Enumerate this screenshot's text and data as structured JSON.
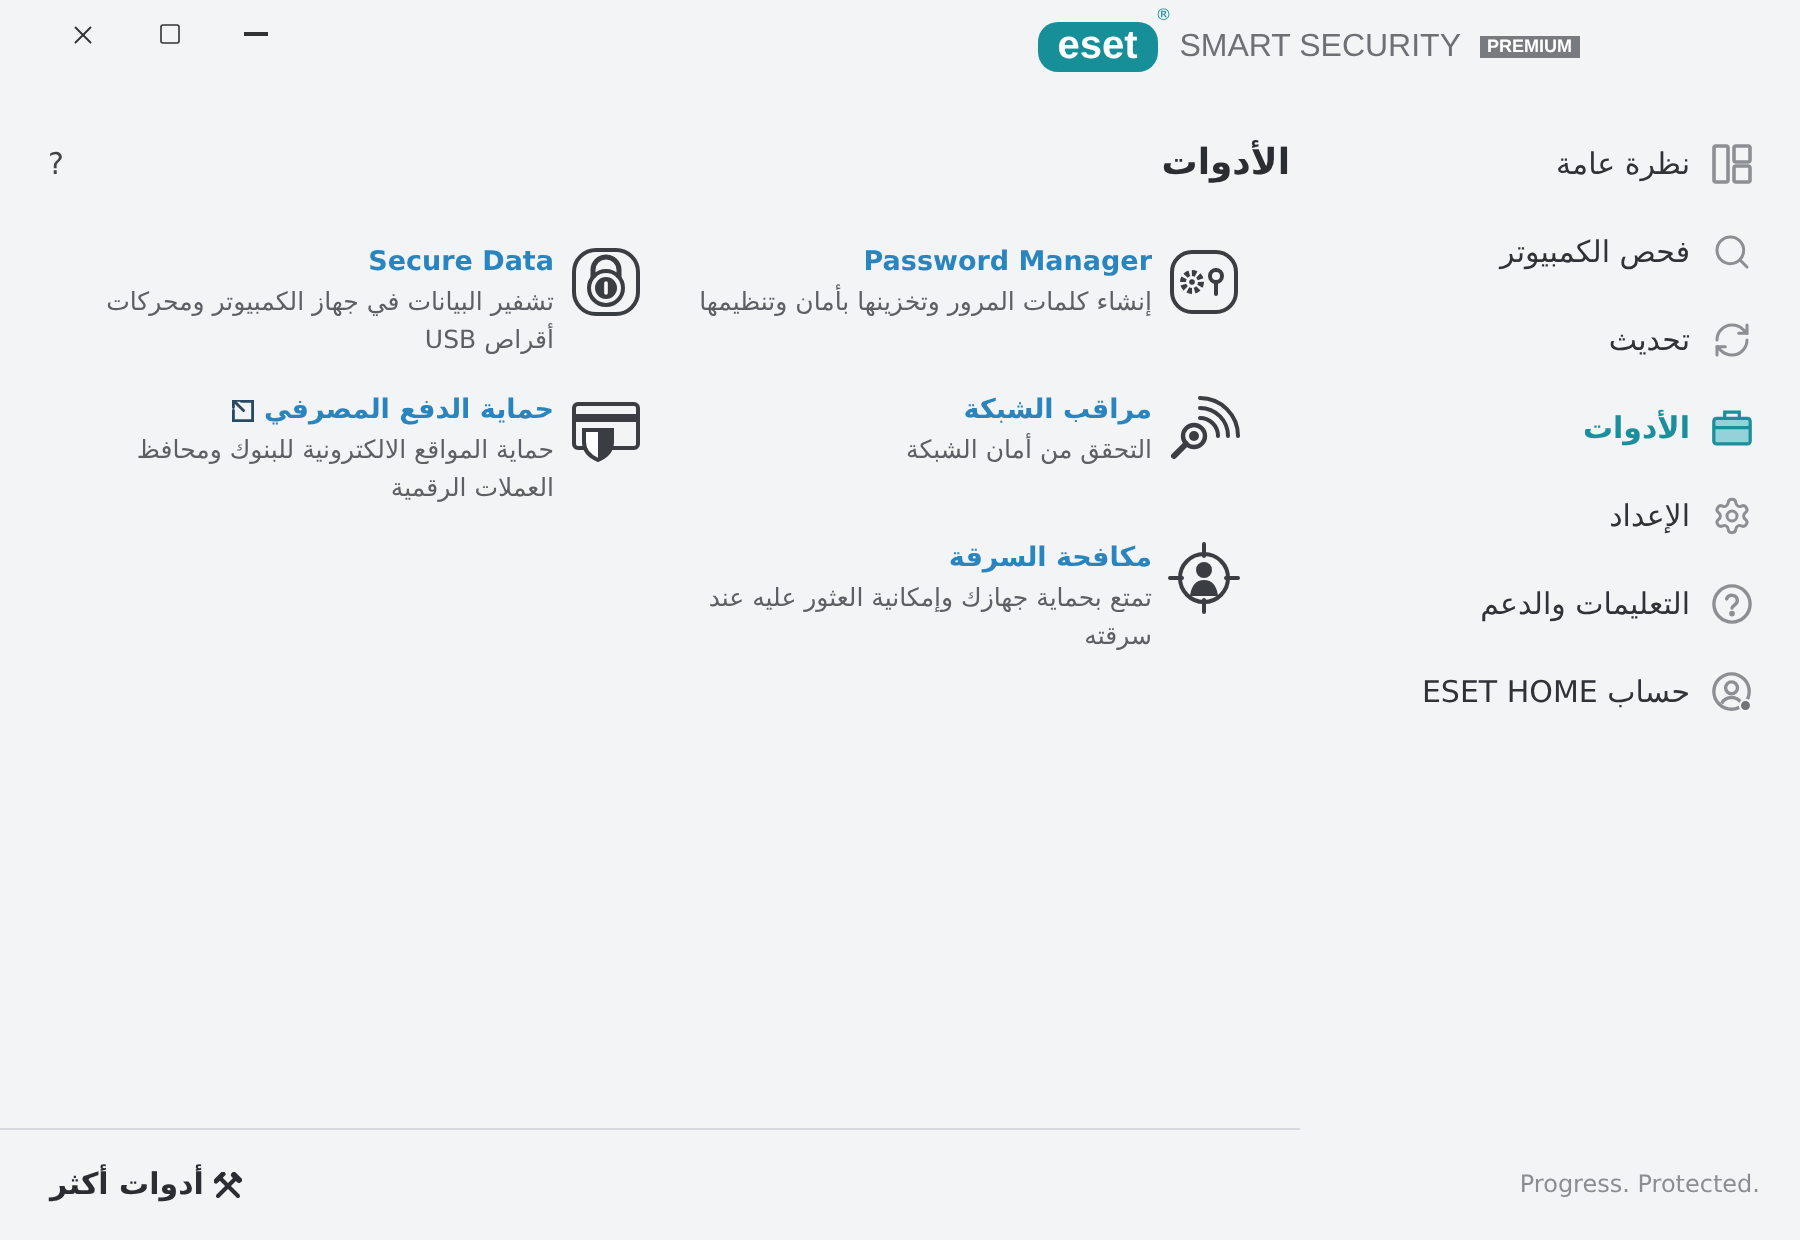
{
  "header": {
    "logo": "eset",
    "registered_mark": "®",
    "product": "SMART SECURITY",
    "edition": "PREMIUM"
  },
  "sidebar": {
    "items": [
      {
        "label": "نظرة عامة",
        "selected": false
      },
      {
        "label": "فحص الكمبيوتر",
        "selected": false
      },
      {
        "label": "تحديث",
        "selected": false
      },
      {
        "label": "الأدوات",
        "selected": true
      },
      {
        "label": "الإعداد",
        "selected": false
      },
      {
        "label": "التعليمات والدعم",
        "selected": false
      },
      {
        "label": "حساب ESET HOME",
        "selected": false
      }
    ],
    "tagline": "Progress. Protected."
  },
  "page": {
    "title": "الأدوات",
    "help": "?"
  },
  "tools": [
    {
      "title": "Password Manager",
      "description": "إنشاء كلمات المرور وتخزينها بأمان وتنظيمها",
      "external_link": false
    },
    {
      "title": "Secure Data",
      "description": "تشفير البيانات في جهاز الكمبيوتر ومحركات أقراص USB",
      "external_link": false
    },
    {
      "title": "مراقب الشبكة",
      "description": "التحقق من أمان الشبكة",
      "external_link": false
    },
    {
      "title": "حماية الدفع المصرفي",
      "description": "حماية المواقع الالكترونية للبنوك ومحافظ العملات الرقمية",
      "external_link": true
    },
    {
      "title": "مكافحة السرقة",
      "description": "تمتع بحماية جهازك وإمكانية العثور عليه عند سرقته",
      "external_link": false
    }
  ],
  "footer": {
    "more_tools": "أدوات أكثر"
  }
}
